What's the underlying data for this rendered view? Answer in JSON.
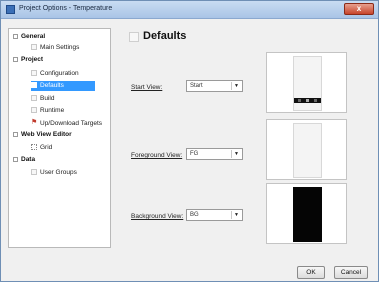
{
  "window": {
    "title": "Project Options - Temperature",
    "close_glyph": "x"
  },
  "sidebar": {
    "items": [
      {
        "label": "General",
        "bold": true
      },
      {
        "label": "Main Settings"
      },
      {
        "label": "Project",
        "bold": true
      },
      {
        "label": "Configuration"
      },
      {
        "label": "Defaults",
        "selected": true
      },
      {
        "label": "Build"
      },
      {
        "label": "Runtime"
      },
      {
        "label": "Up/Download Targets"
      },
      {
        "label": "Web View Editor",
        "bold": true
      },
      {
        "label": "Grid"
      },
      {
        "label": "Data",
        "bold": true
      },
      {
        "label": "User Groups"
      }
    ]
  },
  "content": {
    "title": "Defaults",
    "start_view": {
      "label": "Start View:",
      "value": "Start"
    },
    "foreground_view": {
      "label": "Foreground View:",
      "value": "FG"
    },
    "background_view": {
      "label": "Background View:",
      "value": "BG"
    }
  },
  "footer": {
    "ok": "OK",
    "cancel": "Cancel"
  },
  "colors": {
    "selection": "#3399ff",
    "titlebar": "#b9d0ec",
    "close": "#c7442b"
  }
}
